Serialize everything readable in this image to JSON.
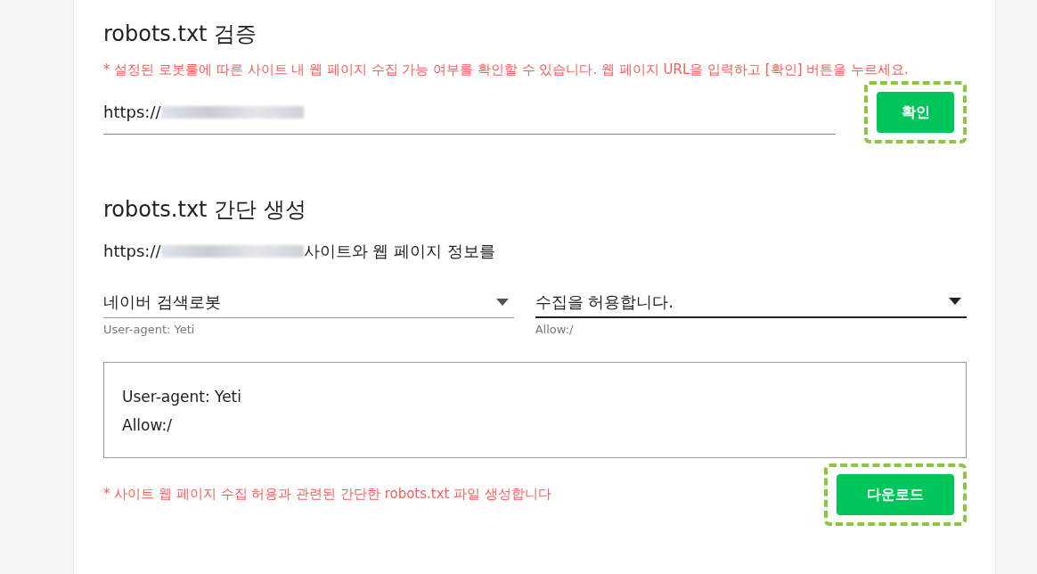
{
  "verify": {
    "title": "robots.txt 검증",
    "note": "* 설정된 로봇룰에 따른 사이트 내 웹 페이지 수집 가능 여부를 확인할 수 있습니다. 웹 페이지 URL을 입력하고 [확인] 버튼을 누르세요.",
    "url_field": {
      "value": "https://",
      "redacted": true
    },
    "button": {
      "label": "확인",
      "highlighted": true
    }
  },
  "generate": {
    "title": "robots.txt 간단 생성",
    "site_line": {
      "prefix": "https://",
      "redacted": true,
      "suffix": "사이트와 웹 페이지 정보를"
    },
    "selects": [
      {
        "value": "네이버 검색로봇",
        "hint": "User-agent: Yeti",
        "focused": false
      },
      {
        "value": "수집을 허용합니다.",
        "hint": "Allow:/",
        "focused": true
      }
    ],
    "output_lines": [
      "User-agent: Yeti",
      "Allow:/"
    ],
    "note": "* 사이트 웹 페이지 수집 허용과 관련된 간단한 robots.txt 파일 생성합니다",
    "button": {
      "label": "다운로드",
      "highlighted": true
    }
  }
}
